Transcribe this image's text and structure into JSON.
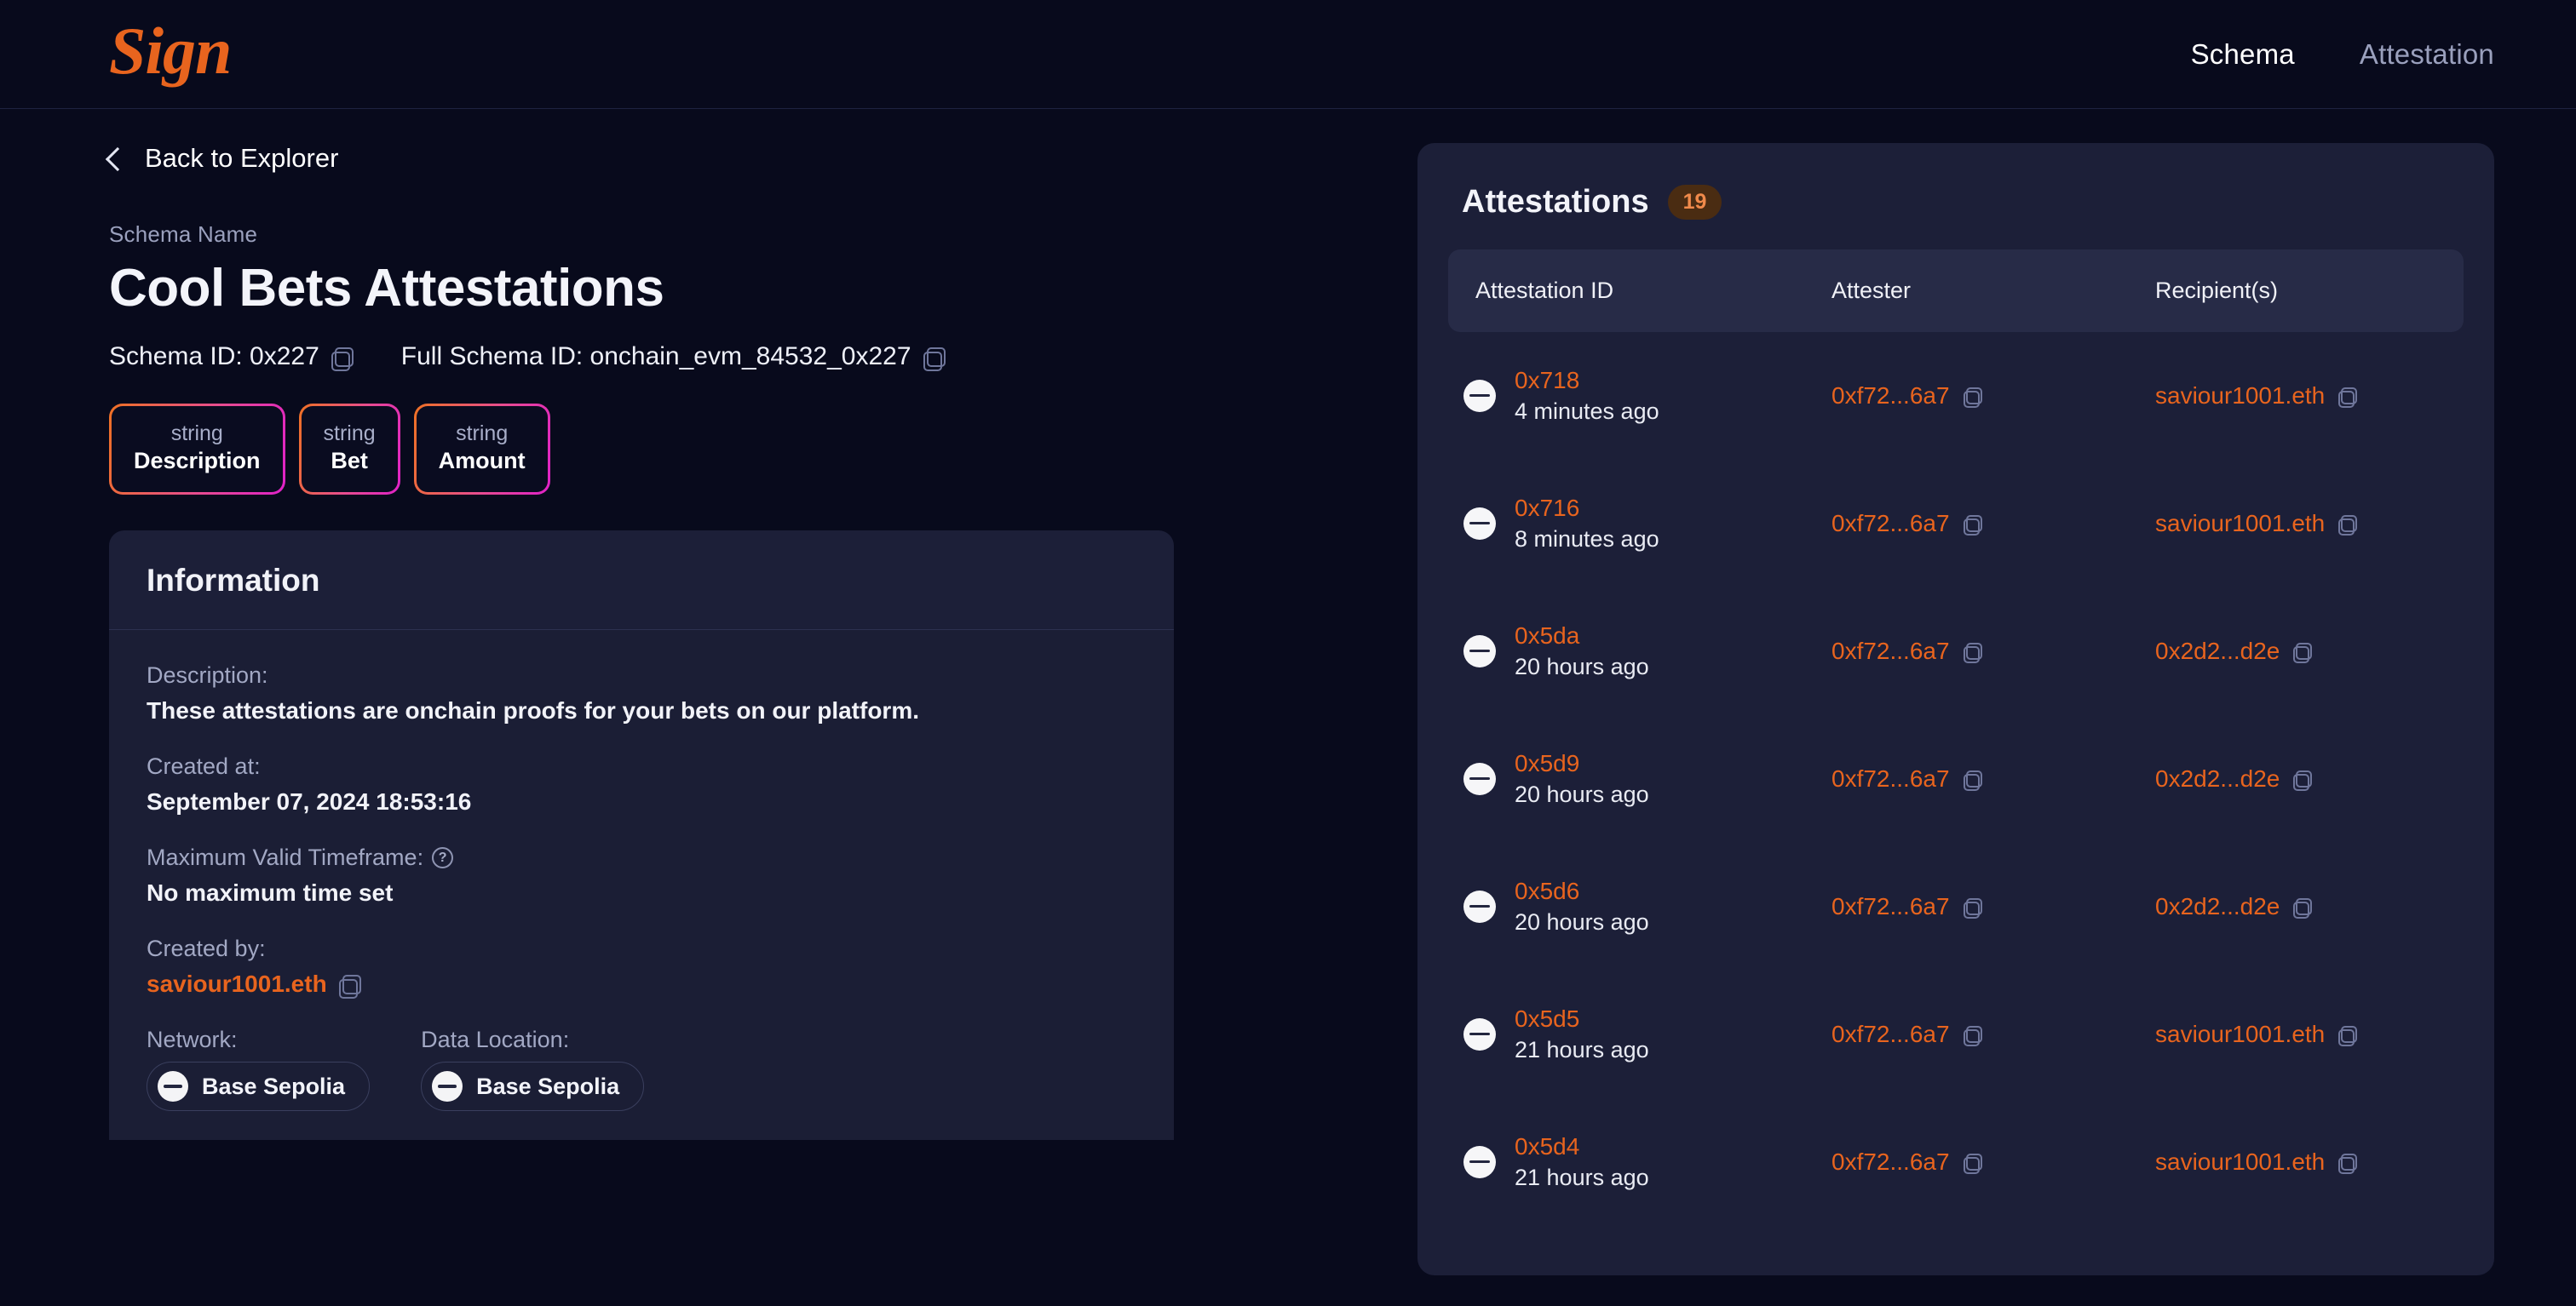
{
  "header": {
    "logo_text": "Sign",
    "nav": [
      {
        "label": "Schema",
        "active": true
      },
      {
        "label": "Attestation",
        "active": false
      }
    ]
  },
  "back_link": {
    "label": "Back to Explorer",
    "icon": "chevron-left-icon"
  },
  "schema": {
    "name_label": "Schema Name",
    "title": "Cool Bets Attestations",
    "schema_id_text": "Schema ID: 0x227",
    "full_schema_id_text": "Full Schema ID: onchain_evm_84532_0x227",
    "fields": [
      {
        "type": "string",
        "name": "Description"
      },
      {
        "type": "string",
        "name": "Bet"
      },
      {
        "type": "string",
        "name": "Amount"
      }
    ]
  },
  "information": {
    "title": "Information",
    "description_label": "Description:",
    "description_value": "These attestations are onchain proofs for your bets on our platform.",
    "created_at_label": "Created at:",
    "created_at_value": "September 07, 2024 18:53:16",
    "max_timeframe_label": "Maximum Valid Timeframe:",
    "max_timeframe_value": "No maximum time set",
    "created_by_label": "Created by:",
    "created_by_value": "saviour1001.eth",
    "network_label": "Network:",
    "network_value": "Base Sepolia",
    "data_location_label": "Data Location:",
    "data_location_value": "Base Sepolia"
  },
  "attestations_panel": {
    "title": "Attestations",
    "count": "19",
    "columns": [
      "Attestation ID",
      "Attester",
      "Recipient(s)"
    ],
    "rows": [
      {
        "id": "0x718",
        "time": "4 minutes ago",
        "attester": "0xf72...6a7",
        "recipient": "saviour1001.eth"
      },
      {
        "id": "0x716",
        "time": "8 minutes ago",
        "attester": "0xf72...6a7",
        "recipient": "saviour1001.eth"
      },
      {
        "id": "0x5da",
        "time": "20 hours ago",
        "attester": "0xf72...6a7",
        "recipient": "0x2d2...d2e"
      },
      {
        "id": "0x5d9",
        "time": "20 hours ago",
        "attester": "0xf72...6a7",
        "recipient": "0x2d2...d2e"
      },
      {
        "id": "0x5d6",
        "time": "20 hours ago",
        "attester": "0xf72...6a7",
        "recipient": "0x2d2...d2e"
      },
      {
        "id": "0x5d5",
        "time": "21 hours ago",
        "attester": "0xf72...6a7",
        "recipient": "saviour1001.eth"
      },
      {
        "id": "0x5d4",
        "time": "21 hours ago",
        "attester": "0xf72...6a7",
        "recipient": "saviour1001.eth"
      }
    ]
  },
  "colors": {
    "accent_orange": "#e8641e",
    "page_bg": "#080a1c",
    "card_bg": "#1c1f38",
    "badge_gradient_start": "#ef7124",
    "badge_gradient_end": "#e021c8",
    "count_pill_bg": "#4a2c12"
  }
}
